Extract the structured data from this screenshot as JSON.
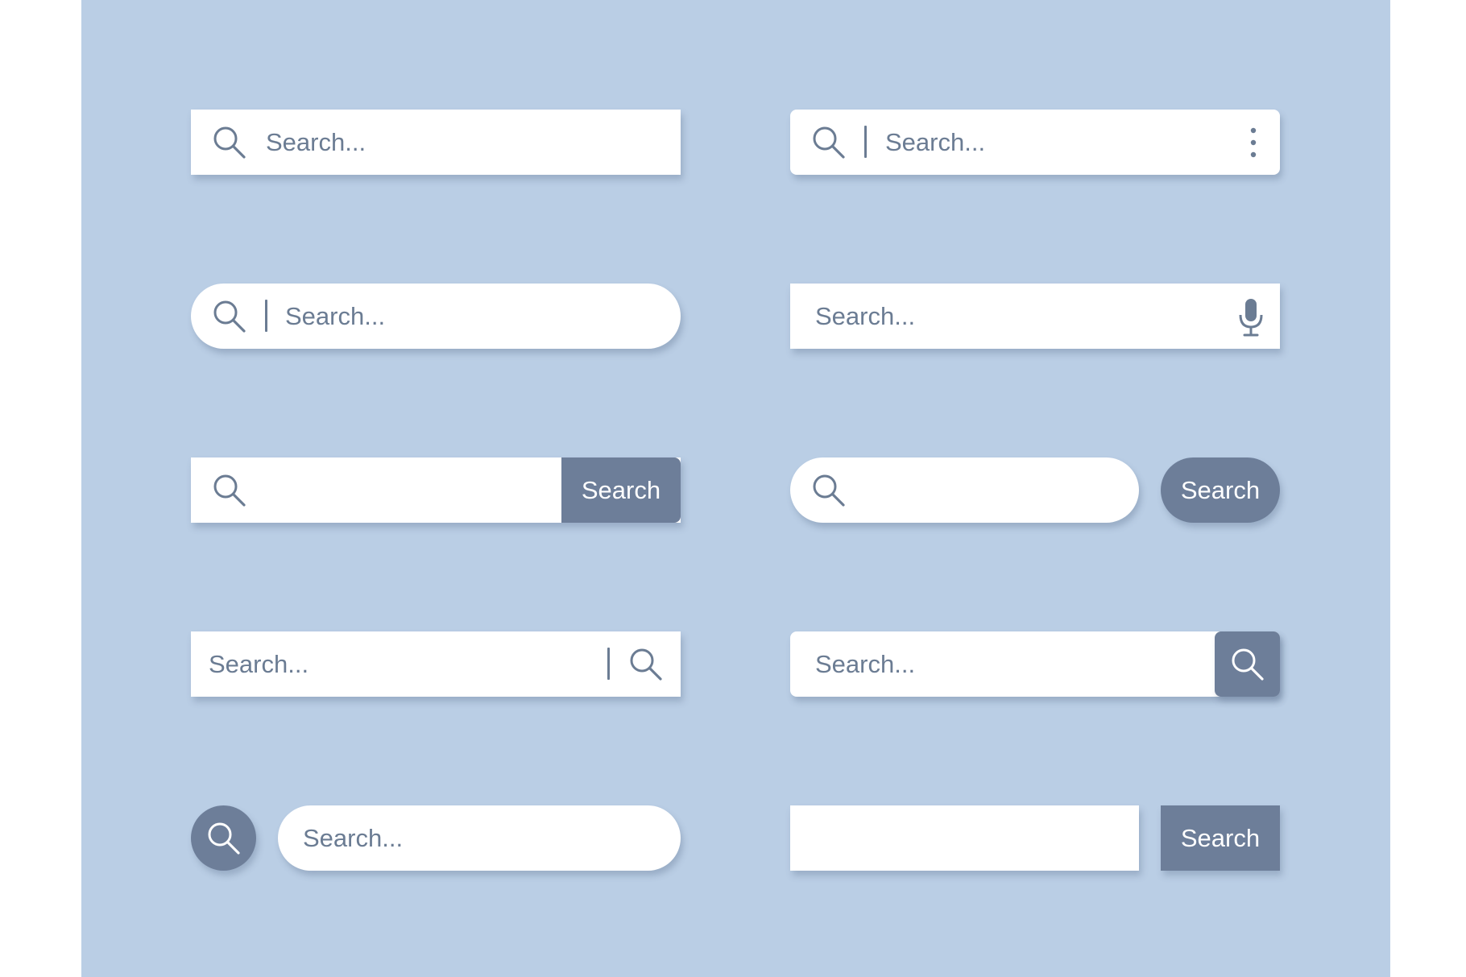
{
  "colors": {
    "background": "#bacee5",
    "field": "#ffffff",
    "accent": "#6d7e99",
    "text": "#6b7c93"
  },
  "icons": {
    "search": "search-icon",
    "menu": "more-vertical-icon",
    "mic": "microphone-icon"
  },
  "bars": {
    "b1": {
      "placeholder": "Search..."
    },
    "b2": {
      "placeholder": "Search..."
    },
    "b3": {
      "placeholder": "Search..."
    },
    "b4": {
      "placeholder": "Search..."
    },
    "b5": {
      "button_label": "Search"
    },
    "b6": {
      "button_label": "Search"
    },
    "b7": {
      "placeholder": "Search..."
    },
    "b8": {
      "placeholder": "Search..."
    },
    "b9": {
      "placeholder": "Search..."
    },
    "b10": {
      "button_label": "Search"
    }
  }
}
